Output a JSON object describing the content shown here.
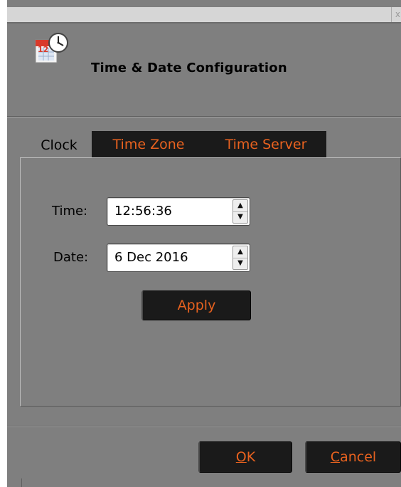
{
  "window": {
    "close_glyph": "x"
  },
  "header": {
    "title": "Time & Date Configuration",
    "icon": "calendar-clock-icon",
    "icon_calendar_text": "12"
  },
  "tabs": [
    {
      "label": "Clock",
      "active": true
    },
    {
      "label": "Time Zone",
      "active": false
    },
    {
      "label": "Time Server",
      "active": false
    }
  ],
  "clock": {
    "time_label": "Time:",
    "time_value": "12:56:36",
    "date_label": "Date:",
    "date_value": "6 Dec 2016",
    "apply_label": "Apply"
  },
  "footer": {
    "ok_mnemonic": "O",
    "ok_rest": "K",
    "cancel_mnemonic": "C",
    "cancel_rest": "ancel"
  },
  "colors": {
    "window_bg": "#7f7f7f",
    "button_bg": "#1a1a1a",
    "accent_text": "#e8621f"
  }
}
